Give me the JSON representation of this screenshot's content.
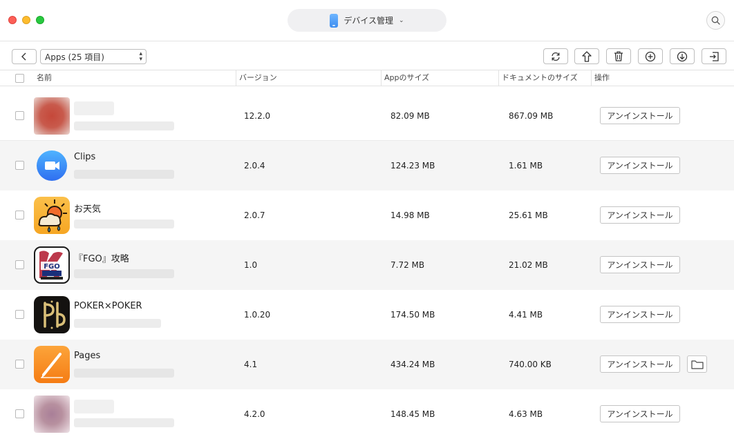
{
  "window": {
    "device_label": "デバイス管理"
  },
  "toolbar": {
    "apps_select_value": "Apps (25 項目)"
  },
  "table": {
    "headers": {
      "name": "名前",
      "version": "バージョン",
      "app_size": "Appのサイズ",
      "doc_size": "ドキュメントのサイズ",
      "action": "操作"
    },
    "uninstall_label": "アンインストール",
    "rows": [
      {
        "name": "",
        "version": "12.2.0",
        "app_size": "82.09 MB",
        "doc_size": "867.09 MB",
        "icon": "blurred-app-icon"
      },
      {
        "name": "Clips",
        "version": "2.0.4",
        "app_size": "124.23 MB",
        "doc_size": "1.61 MB",
        "icon": "clips-app-icon"
      },
      {
        "name": "お天気",
        "version": "2.0.7",
        "app_size": "14.98 MB",
        "doc_size": "25.61 MB",
        "icon": "weather-app-icon"
      },
      {
        "name": "『FGO』攻略",
        "version": "1.0",
        "app_size": "7.72 MB",
        "doc_size": "21.02 MB",
        "icon": "fgo-app-icon"
      },
      {
        "name": "POKER×POKER",
        "version": "1.0.20",
        "app_size": "174.50 MB",
        "doc_size": "4.41 MB",
        "icon": "poker-app-icon"
      },
      {
        "name": "Pages",
        "version": "4.1",
        "app_size": "434.24 MB",
        "doc_size": "740.00 KB",
        "icon": "pages-app-icon"
      },
      {
        "name": "",
        "version": "4.2.0",
        "app_size": "148.45 MB",
        "doc_size": "4.63 MB",
        "icon": "blurred-app-icon"
      }
    ]
  },
  "colors": {
    "close": "#fc5f57",
    "minimize": "#fdbc2e",
    "zoom": "#28c840",
    "row_alt": "#f5f5f5",
    "clips_blue": "#3a95f5",
    "pages_orange": "#f7941d"
  },
  "icons": [
    "search-icon",
    "chevron-left-icon",
    "refresh-icon",
    "upload-icon",
    "trash-icon",
    "add-icon",
    "download-icon",
    "import-icon",
    "folder-icon",
    "phone-icon"
  ]
}
